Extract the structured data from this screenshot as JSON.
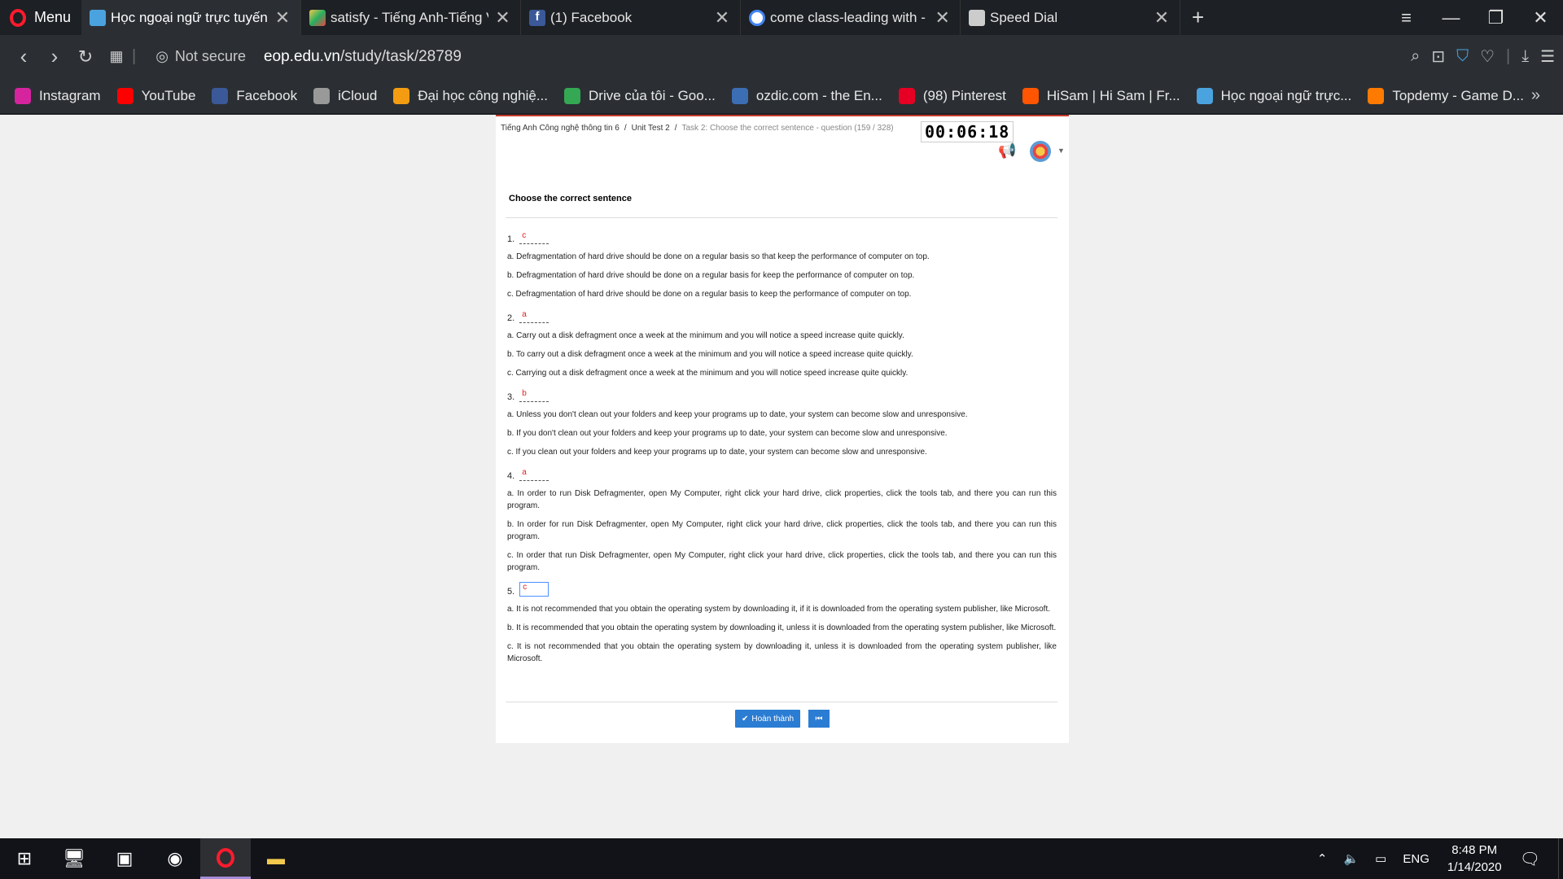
{
  "browser": {
    "menu_label": "Menu",
    "tabs": [
      {
        "title": "Học ngoại ngữ trực tuyến",
        "active": true,
        "icon_color": "#4aa3df"
      },
      {
        "title": "satisfy - Tiếng Anh-Tiếng V",
        "active": false,
        "icon_color": "#f2c94c"
      },
      {
        "title": "(1) Facebook",
        "active": false,
        "icon_color": "#3b5998"
      },
      {
        "title": "come class-leading with - T",
        "active": false,
        "icon_color": "#ffffff"
      },
      {
        "title": "Speed Dial",
        "active": false,
        "icon_color": "#cccccc"
      }
    ],
    "not_secure": "Not secure",
    "url_host": "eop.edu.vn",
    "url_path": "/study/task/28789",
    "bookmarks": [
      {
        "label": "Instagram",
        "icon": "instagram-icon",
        "color": "#d6249f"
      },
      {
        "label": "YouTube",
        "icon": "youtube-icon",
        "color": "#ff0000"
      },
      {
        "label": "Facebook",
        "icon": "facebook-icon",
        "color": "#3b5998"
      },
      {
        "label": "iCloud",
        "icon": "apple-icon",
        "color": "#999999"
      },
      {
        "label": "Đại học công nghiệ...",
        "icon": "university-icon",
        "color": "#f39c12"
      },
      {
        "label": "Drive của tôi - Goo...",
        "icon": "drive-icon",
        "color": "#34a853"
      },
      {
        "label": "ozdic.com - the En...",
        "icon": "ozdic-icon",
        "color": "#3c6eb4"
      },
      {
        "label": "(98) Pinterest",
        "icon": "pinterest-icon",
        "color": "#e60023"
      },
      {
        "label": "HiSam | Hi Sam | Fr...",
        "icon": "soundcloud-icon",
        "color": "#ff5500"
      },
      {
        "label": "Học ngoại ngữ trực...",
        "icon": "eop-icon",
        "color": "#4aa3df"
      },
      {
        "label": "Topdemy - Game D...",
        "icon": "topdemy-icon",
        "color": "#ff7a00"
      }
    ]
  },
  "page": {
    "breadcrumb": {
      "course": "Tiếng Anh Công nghệ thông tin 6",
      "unit": "Unit Test 2",
      "current": "Task 2: Choose the correct sentence - question (159 / 328)"
    },
    "timer": "00:06:18",
    "heading": "Choose the correct sentence",
    "questions": [
      {
        "num": "1.",
        "answer": "c",
        "options": [
          "a. Defragmentation of hard drive should be done on a regular basis so that keep the performance of computer on top.",
          "b. Defragmentation of hard drive should be done on a regular basis for keep the performance of computer on top.",
          "c. Defragmentation of hard drive should be done on a regular basis to keep the performance of computer on top."
        ]
      },
      {
        "num": "2.",
        "answer": "a",
        "options": [
          "a. Carry out a disk defragment once a week at the minimum and you will notice a speed increase quite quickly.",
          "b. To carry out a disk defragment once a week at the minimum and you will notice a speed increase quite quickly.",
          "c. Carrying out a disk defragment once a week at the minimum and you will notice speed increase quite quickly."
        ]
      },
      {
        "num": "3.",
        "answer": "b",
        "options": [
          "a. Unless you don't clean out your folders and keep your programs up to date, your system can become slow and unresponsive.",
          "b. If you don't clean out your folders and keep your programs up to date, your system can become slow and unresponsive.",
          "c. If you clean out your folders and keep your programs up to date, your system can become slow and unresponsive."
        ]
      },
      {
        "num": "4.",
        "answer": "a",
        "options": [
          "a. In order to run Disk Defragmenter, open My Computer, right click your hard drive, click properties, click the tools tab, and there you can run this program.",
          "b. In order for run Disk Defragmenter, open My Computer, right click your hard drive, click properties, click the tools tab, and there you can run this program.",
          "c. In order that run Disk Defragmenter, open My Computer, right click your hard drive, click properties, click the tools tab, and there you can run this program."
        ]
      },
      {
        "num": "5.",
        "answer": "c",
        "options": [
          "a. It is not recommended that you obtain the operating system by downloading it, if it is downloaded from the operating system publisher, like Microsoft.",
          "b. It is recommended that you obtain the operating system by downloading it, unless it is downloaded from the operating system publisher, like Microsoft.",
          "c. It is not recommended that you obtain the operating system by downloading it, unless it is downloaded from the operating system publisher, like Microsoft."
        ]
      }
    ],
    "submit_label": "Hoàn thành"
  },
  "taskbar": {
    "language": "ENG",
    "time": "8:48 PM",
    "date": "1/14/2020"
  }
}
